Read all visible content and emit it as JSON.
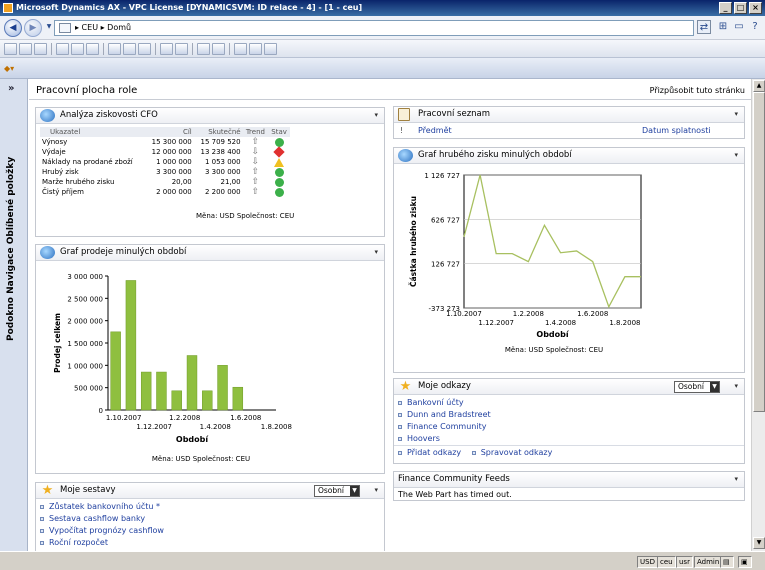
{
  "window": {
    "title": "Microsoft Dynamics AX - VPC License [DYNAMICSVM: ID relace - 4] - [1 - ceu]"
  },
  "address": {
    "path": "▸  CEU  ▸  Domů"
  },
  "nav": {
    "vertical_label": "Podokno Navigace Oblíbené položky",
    "collapse": "»"
  },
  "page": {
    "title": "Pracovní plocha role",
    "customize": "Přizpůsobit tuto stránku"
  },
  "kpi": {
    "title": "Analýza ziskovosti CFO",
    "headers": [
      "Ukazatel",
      "Cíl",
      "Skutečné",
      "Trend",
      "Stav"
    ],
    "rows": [
      {
        "name": "Výnosy",
        "target": "15 300 000",
        "actual": "15 709 520",
        "trend": "up",
        "status": "green"
      },
      {
        "name": "Výdaje",
        "target": "12 000 000",
        "actual": "13 238 400",
        "trend": "down",
        "status": "red"
      },
      {
        "name": "Náklady na prodané zboží",
        "target": "1 000 000",
        "actual": "1 053 000",
        "trend": "down",
        "status": "yellow"
      },
      {
        "name": "Hrubý zisk",
        "target": "3 300 000",
        "actual": "3 300 000",
        "trend": "up",
        "status": "green"
      },
      {
        "name": "Marže hrubého zisku",
        "target": "20,00",
        "actual": "21,00",
        "trend": "up",
        "status": "green"
      },
      {
        "name": "Čistý příjem",
        "target": "2 000 000",
        "actual": "2 200 000",
        "trend": "up",
        "status": "green"
      }
    ],
    "footer": "Měna: USD Společnost: CEU"
  },
  "sales": {
    "title": "Graf prodeje minulých období",
    "footer": "Měna: USD Společnost: CEU"
  },
  "profit": {
    "title": "Graf hrubého zisku minulých období",
    "footer": "Měna: USD Společnost: CEU"
  },
  "worklist": {
    "title": "Pracovní seznam",
    "col_subject": "Předmět",
    "col_due": "Datum splatnosti",
    "flag": "!"
  },
  "links": {
    "title": "Moje odkazy",
    "dropdown": "Osobní",
    "items": [
      "Bankovní účty",
      "Dunn and Bradstreet",
      "Finance Community",
      "Hoovers"
    ],
    "add": "Přidat odkazy",
    "manage": "Spravovat odkazy"
  },
  "reports": {
    "title": "Moje sestavy",
    "dropdown": "Osobní",
    "items": [
      "Zůstatek bankovního účtu *",
      "Sestava cashflow banky",
      "Vypočítat prognózy cashflow",
      "Roční rozpočet"
    ]
  },
  "feeds": {
    "title": "Finance Community Feeds",
    "message": "The Web Part has timed out."
  },
  "status": {
    "cells": [
      "USD",
      "ceu",
      "usr",
      "Admin"
    ]
  },
  "colors": {
    "bar": "#8fbf3f",
    "line": "#a8c060",
    "titlebar": "#0a246a"
  },
  "chart_data": [
    {
      "type": "bar",
      "ylabel": "Prodej celkem",
      "xlabel": "Období",
      "ylim": [
        0,
        3000000
      ],
      "yticks": [
        "3 000 000",
        "2 500 000",
        "2 000 000",
        "1 500 000",
        "1 000 000",
        "500 000",
        "0"
      ],
      "xticks": [
        "1.10.2007",
        "1.12.2007",
        "1.2.2008",
        "1.4.2008",
        "1.6.2008",
        "1.8.2008"
      ],
      "values": [
        1750000,
        2900000,
        850000,
        850000,
        430000,
        1220000,
        430000,
        1000000,
        510000,
        0,
        0
      ]
    },
    {
      "type": "line",
      "ylabel": "Částka hrubého zisku",
      "xlabel": "Období",
      "ylim": [
        -373273,
        1126727
      ],
      "yticks": [
        "1 126 727",
        "626 727",
        "126 727",
        "-373 273"
      ],
      "xticks": [
        "1.10.2007",
        "1.12.2007",
        "1.2.2008",
        "1.4.2008",
        "1.6.2008",
        "1.8.2008"
      ],
      "values": [
        430000,
        1126727,
        240000,
        240000,
        150000,
        560000,
        250000,
        270000,
        150000,
        -360000,
        -20000,
        -20000
      ]
    }
  ]
}
